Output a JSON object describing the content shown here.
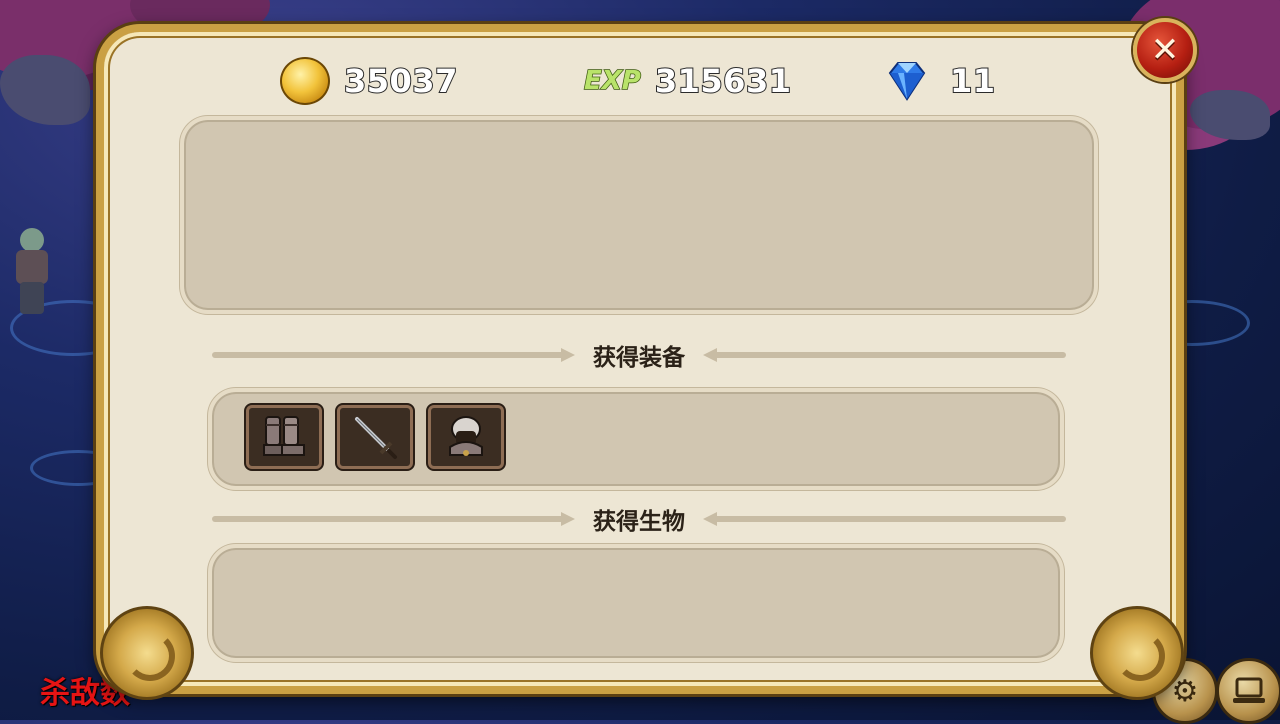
{
  "hud": {
    "kill_count_label": "杀敌数",
    "settings_icon": "gear-icon",
    "laptop_icon": "laptop-icon"
  },
  "resources": {
    "gold": {
      "icon": "gold-coin-icon",
      "value": "35037"
    },
    "exp": {
      "icon_text": "EXP",
      "value": "315631"
    },
    "gems": {
      "icon": "diamond-icon",
      "value": "11"
    }
  },
  "sections": {
    "equipment": {
      "title": "获得装备",
      "items": [
        {
          "icon": "boots-icon"
        },
        {
          "icon": "sword-icon"
        },
        {
          "icon": "helmet-icon"
        }
      ]
    },
    "creatures": {
      "title": "获得生物",
      "items": []
    }
  },
  "colors": {
    "panel_bg": "#ede6d4",
    "panel_border": "#caa043",
    "close_button": "#b51f12",
    "kill_text": "#e61414"
  }
}
